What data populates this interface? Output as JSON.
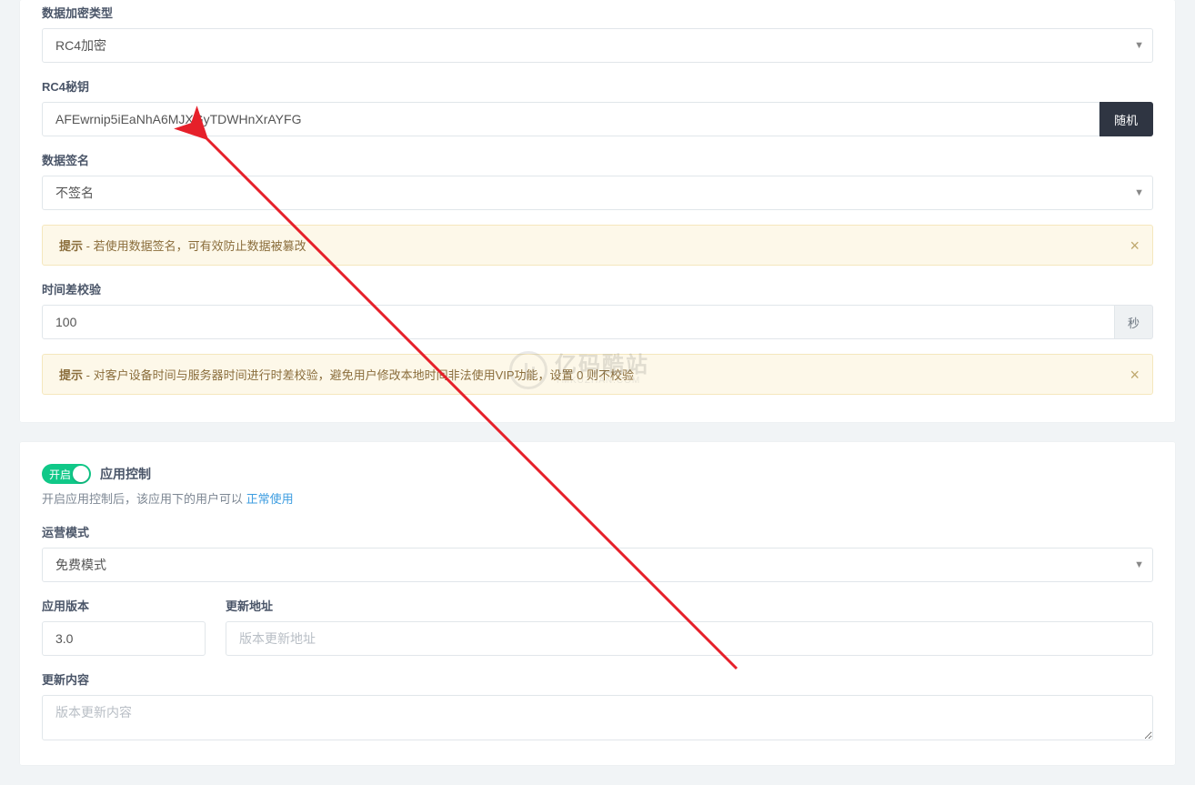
{
  "encryption": {
    "label": "数据加密类型",
    "value": "RC4加密"
  },
  "rc4": {
    "key_label": "RC4秘钥",
    "key_value": "AFEwrnip5iEaNhA6MJXGyTDWHnXrAYFG",
    "random_button": "随机"
  },
  "signature": {
    "label": "数据签名",
    "value": "不签名",
    "tip_prefix": "提示",
    "tip_text": " - 若使用数据签名，可有效防止数据被篡改"
  },
  "timediff": {
    "label": "时间差校验",
    "value": "100",
    "unit": "秒",
    "tip_prefix": "提示",
    "tip_text": " - 对客户设备时间与服务器时间进行时差校验，避免用户修改本地时间非法使用VIP功能，设置 0 则不校验"
  },
  "appcontrol": {
    "toggle_label": "开启",
    "title": "应用控制",
    "helper_prefix": "开启应用控制后，该应用下的用户可以 ",
    "helper_link": "正常使用"
  },
  "opmode": {
    "label": "运营模式",
    "value": "免费模式"
  },
  "version": {
    "label": "应用版本",
    "value": "3.0"
  },
  "update_url": {
    "label": "更新地址",
    "placeholder": "版本更新地址"
  },
  "update_content": {
    "label": "更新内容",
    "placeholder": "版本更新内容"
  },
  "watermark": {
    "cn": "亿码酷站",
    "en": "YMKUZHAN.COM"
  },
  "icons": {
    "close": "×",
    "caret": "▼"
  }
}
